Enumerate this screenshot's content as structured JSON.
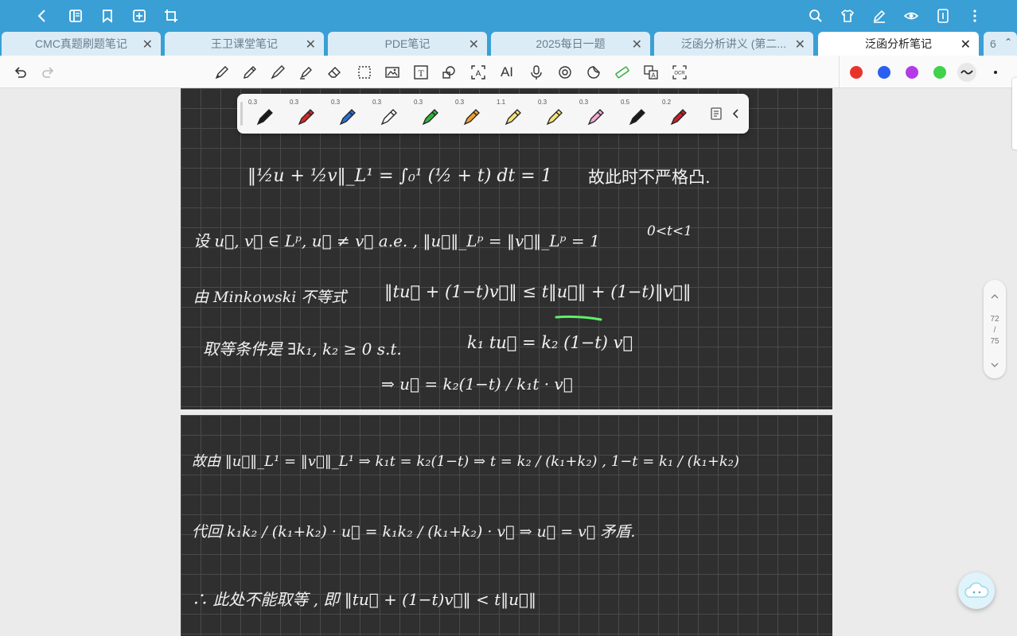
{
  "tabs": [
    {
      "label": "CMC真题刷题笔记",
      "active": false
    },
    {
      "label": "王卫课堂笔记",
      "active": false
    },
    {
      "label": "PDE笔记",
      "active": false
    },
    {
      "label": "2025每日一题",
      "active": false
    },
    {
      "label": "泛函分析讲义 (第二...",
      "active": false
    },
    {
      "label": "泛函分析笔记",
      "active": true
    }
  ],
  "tab_overflow_count": "6",
  "tab_close_glyph": "✕",
  "colors": {
    "appbar": "#3a9fd5",
    "palette": [
      "#e8352b",
      "#2a5ff0",
      "#b43ae8",
      "#3fd24a"
    ]
  },
  "pens": [
    {
      "size": "0.3",
      "color": "#1a1a1a"
    },
    {
      "size": "0.3",
      "color": "#d12a2a"
    },
    {
      "size": "0.3",
      "color": "#2a6fd6"
    },
    {
      "size": "0.3",
      "color": "#ffffff"
    },
    {
      "size": "0.3",
      "color": "#2fb33a"
    },
    {
      "size": "0.3",
      "color": "#f0a030"
    },
    {
      "size": "1.1",
      "color": "#f4e27a"
    },
    {
      "size": "0.3",
      "color": "#f4e27a"
    },
    {
      "size": "0.3",
      "color": "#f2a9d0"
    },
    {
      "size": "0.5",
      "color": "#1a1a1a"
    },
    {
      "size": "0.2",
      "color": "#c8202a"
    }
  ],
  "toolbar": {
    "text_tool_label": "T",
    "ai_label": "AI",
    "ocr_label": "OCR"
  },
  "pager": {
    "current": "72",
    "sep": "/",
    "total": "75"
  },
  "notes": {
    "page1": [
      "‖½u + ½v‖_L¹ = ∫₀¹ (½ + t) dt = 1",
      "故此时不严格凸.",
      "设 u⃗, v⃗ ∈ Lᵖ,  u⃗ ≠ v⃗  a.e. , ‖u⃗‖_Lᵖ = ‖v⃗‖_Lᵖ = 1",
      "0<t<1",
      "由 Minkowski 不等式",
      "‖tu⃗ + (1−t)v⃗‖  ≤  t‖u⃗‖ + (1−t)‖v⃗‖",
      "取等条件是 ∃k₁, k₂ ≥ 0  s.t.",
      "k₁ tu⃗ = k₂ (1−t) v⃗",
      "⇒ u⃗ = k₂(1−t) / k₁t · v⃗"
    ],
    "page2": [
      "故由 ‖u⃗‖_L¹ = ‖v⃗‖_L¹  ⇒  k₁t = k₂(1−t)  ⇒  t = k₂ / (k₁+k₂) ,  1−t = k₁ / (k₁+k₂)",
      "代回  k₁k₂ / (k₁+k₂) · u⃗  =  k₁k₂ / (k₁+k₂) · v⃗   ⇒   u⃗ = v⃗   矛盾.",
      "∴ 此处不能取等 ,  即  ‖tu⃗ + (1−t)v⃗‖ < t‖u⃗‖"
    ]
  }
}
